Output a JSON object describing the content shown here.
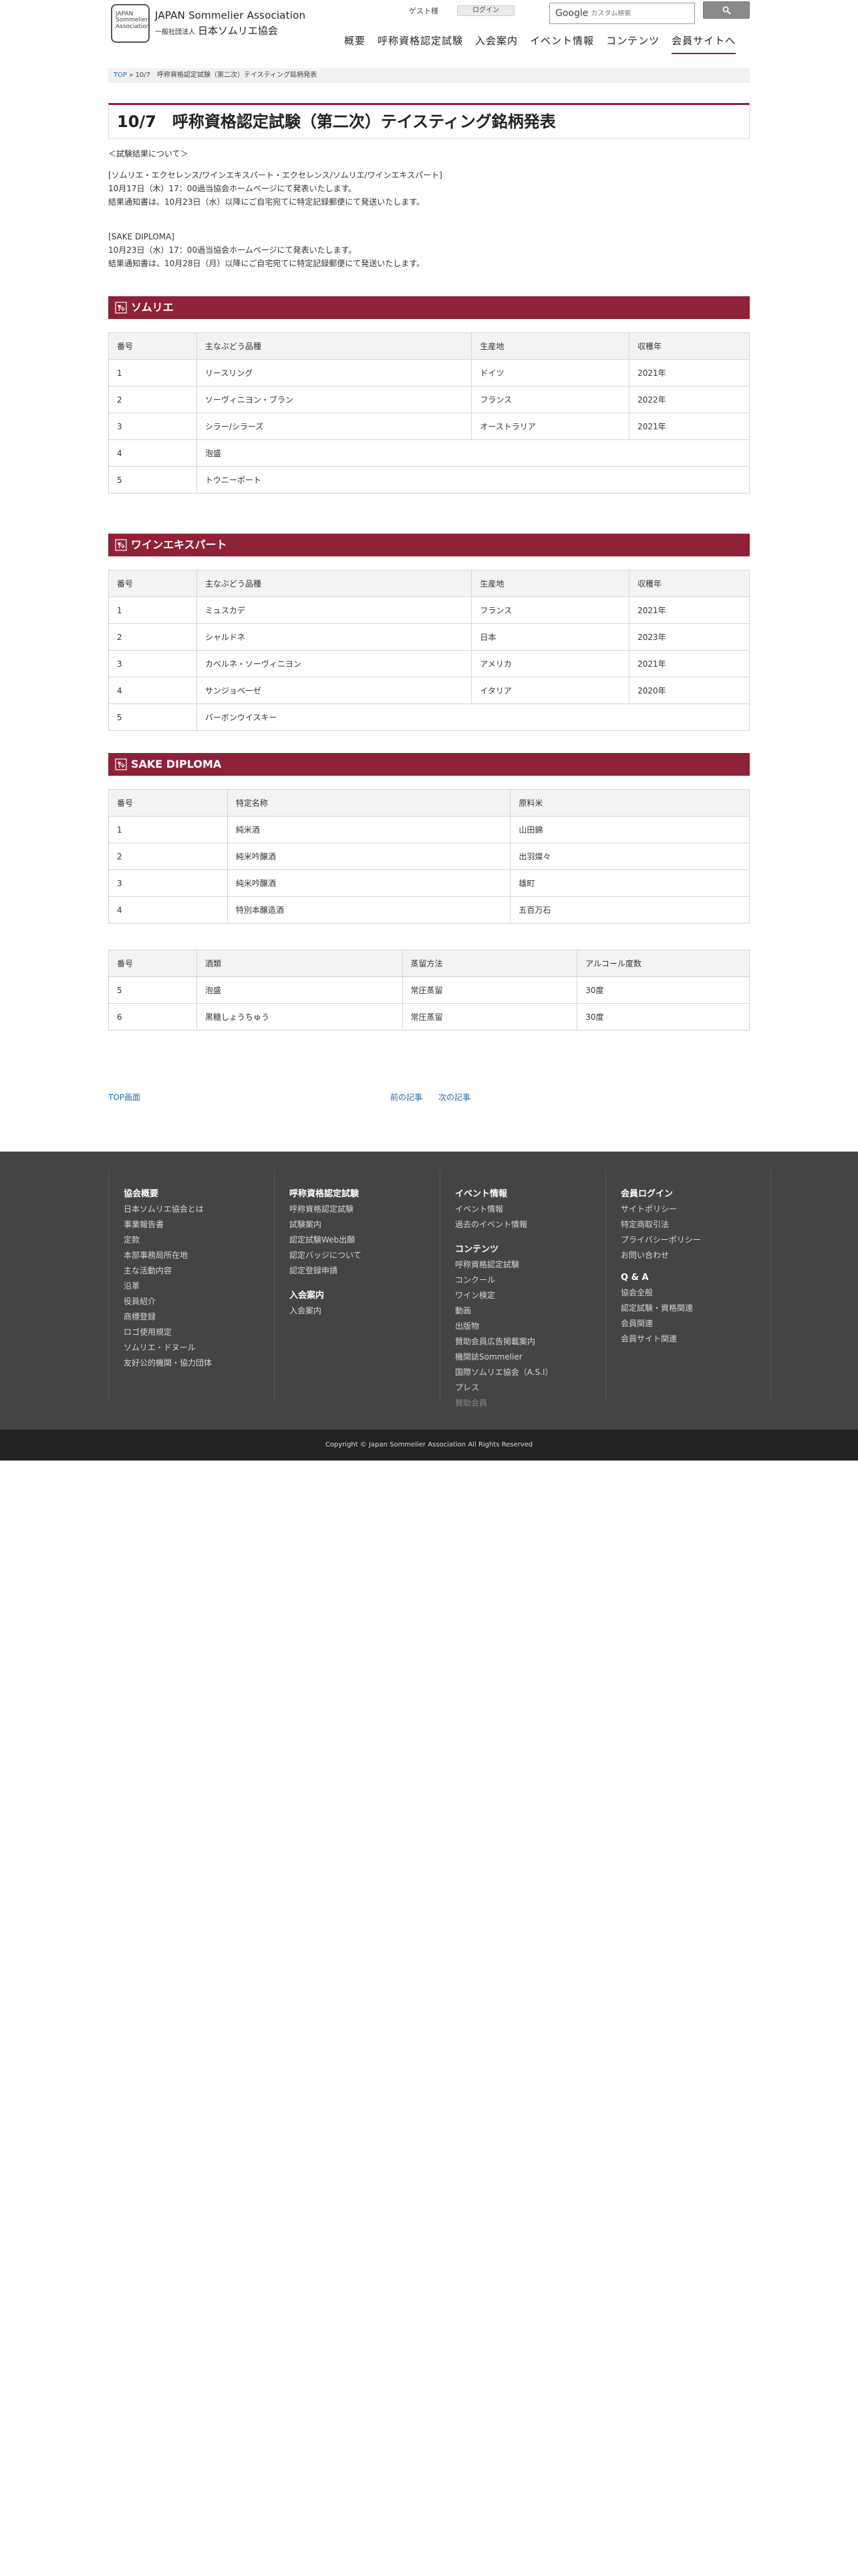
{
  "header": {
    "logo_mark_text": "JAPAN Sommelier Association",
    "logo_en": "JAPAN Sommelier Association",
    "logo_jp_small": "一般社団法人",
    "logo_jp": "日本ソムリエ協会",
    "guest": "ゲスト様",
    "login": "ログイン",
    "search_brand": "Google",
    "search_placeholder": "カスタム検索",
    "nav": [
      "概要",
      "呼称資格認定試験",
      "入会案内",
      "イベント情報",
      "コンテンツ",
      "会員サイトへ"
    ]
  },
  "breadcrumb": {
    "top": "TOP",
    "sep": "»",
    "current": "10/7　呼称資格認定試験（第二次）テイスティング銘柄発表"
  },
  "page_title": "10/7　呼称資格認定試験（第二次）テイスティング銘柄発表",
  "intro": {
    "heading": "＜試験結果について＞",
    "sommelier_label": "[ソムリエ・エクセレンス/ワインエキスパート・エクセレンス/ソムリエ/ワインエキスパート]",
    "sommelier_line1": "10月17日（木）17：00過当協会ホームページにて発表いたします。",
    "sommelier_line2": "結果通知書は、10月23日（水）以降にご自宅宛てに特定記録郵便にて発送いたします。",
    "sake_label": "[SAKE DIPLOMA]",
    "sake_line1": "10月23日（水）17：00過当協会ホームページにて発表いたします。",
    "sake_line2": "結果通知書は、10月28日（月）以降にご自宅宛てに特定記録郵便にて発送いたします。"
  },
  "sections": {
    "sommelier": {
      "title": "ソムリエ",
      "headers": [
        "番号",
        "主なぶどう品種",
        "生産地",
        "収穫年"
      ],
      "rows": [
        [
          "1",
          "リースリング",
          "ドイツ",
          "2021年"
        ],
        [
          "2",
          "ソーヴィニヨン・ブラン",
          "フランス",
          "2022年"
        ],
        [
          "3",
          "シラー/シラーズ",
          "オーストラリア",
          "2021年"
        ],
        [
          "4",
          "泡盛",
          "",
          ""
        ],
        [
          "5",
          "トウニーポート",
          "",
          ""
        ]
      ]
    },
    "wine_expert": {
      "title": "ワインエキスパート",
      "headers": [
        "番号",
        "主なぶどう品種",
        "生産地",
        "収穫年"
      ],
      "rows": [
        [
          "1",
          "ミュスカデ",
          "フランス",
          "2021年"
        ],
        [
          "2",
          "シャルドネ",
          "日本",
          "2023年"
        ],
        [
          "3",
          "カベルネ・ソーヴィニヨン",
          "アメリカ",
          "2021年"
        ],
        [
          "4",
          "サンジョベーゼ",
          "イタリア",
          "2020年"
        ],
        [
          "5",
          "バーボンウイスキー",
          "",
          ""
        ]
      ]
    },
    "sake": {
      "title": "SAKE DIPLOMA",
      "headers": [
        "番号",
        "特定名称",
        "原料米"
      ],
      "rows": [
        [
          "1",
          "純米酒",
          "山田錦"
        ],
        [
          "2",
          "純米吟醸酒",
          "出羽燦々"
        ],
        [
          "3",
          "純米吟醸酒",
          "雄町"
        ],
        [
          "4",
          "特別本醸造酒",
          "五百万石"
        ]
      ],
      "headers2": [
        "番号",
        "酒類",
        "蒸留方法",
        "アルコール度数"
      ],
      "rows2": [
        [
          "5",
          "泡盛",
          "常圧蒸留",
          "30度"
        ],
        [
          "6",
          "黒糖しょうちゅう",
          "常圧蒸留",
          "30度"
        ]
      ]
    }
  },
  "pager": {
    "top": "TOP画面",
    "prev": "前の記事",
    "next": "次の記事"
  },
  "footer": {
    "col1": {
      "title": "協会概要",
      "links": [
        "日本ソムリエ協会とは",
        "事業報告書",
        "定款",
        "本部事務局所在地",
        "主な活動内容",
        "沿革",
        "役員紹介",
        "商標登録",
        "ロゴ使用規定",
        "ソムリエ・ドヌール",
        "友好公的機関・協力団体"
      ]
    },
    "col2": {
      "title": "呼称資格認定試験",
      "links": [
        "呼称資格認定試験",
        "試験案内",
        "認定試験Web出願",
        "認定バッジについて",
        "認定登録申請"
      ],
      "title2": "入会案内",
      "links2": [
        "入会案内"
      ]
    },
    "col3": {
      "title": "イベント情報",
      "links": [
        "イベント情報",
        "過去のイベント情報"
      ],
      "title2": "コンテンツ",
      "links2": [
        "呼称資格認定試験",
        "コンクール",
        "ワイン検定",
        "動画",
        "出版物",
        "賛助会員広告掲載案内",
        "機関誌Sommelier",
        "国際ソムリエ協会（A.S.I）",
        "プレス"
      ],
      "dim": "賛助会員"
    },
    "col4": {
      "title": "会員ログイン",
      "links": [
        "サイトポリシー",
        "特定商取引法",
        "プライバシーポリシー",
        "お問い合わせ"
      ],
      "title2": "Q & A",
      "links2": [
        "協会全般",
        "認定試験・資格関連",
        "会員関連",
        "会員サイト関連"
      ]
    }
  },
  "copyright": "Copyright © Japan Sommelier Association All Rights Reserved",
  "colors": {
    "accent": "#8f2238",
    "footer_bg": "#444444",
    "copyright_bg": "#222222",
    "link": "#2a6bb0"
  }
}
